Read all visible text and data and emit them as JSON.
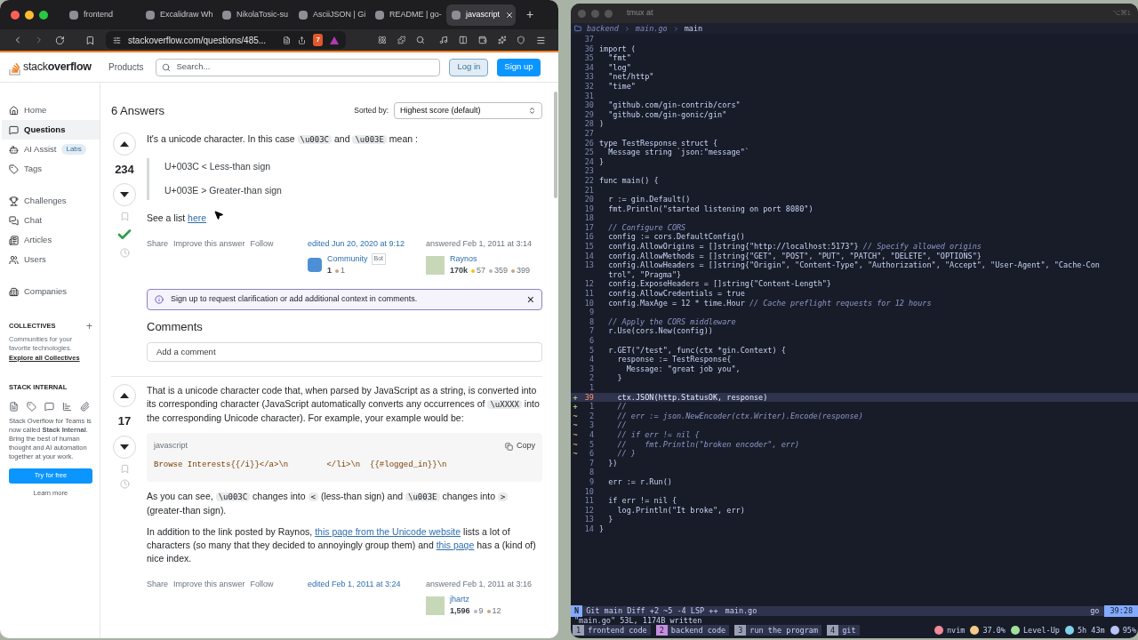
{
  "browser": {
    "tabs": [
      {
        "title": "frontend",
        "selected": false
      },
      {
        "title": "Excalidraw Wh",
        "selected": false
      },
      {
        "title": "NikolaTosic-su",
        "selected": false
      },
      {
        "title": "AsciiJSON | Gi",
        "selected": false
      },
      {
        "title": "README | go-",
        "selected": false
      },
      {
        "title": "javascript",
        "selected": true
      }
    ],
    "url": "stackoverflow.com/questions/485...",
    "shield_count": "7",
    "new_tab": "+"
  },
  "header": {
    "logo": "stack**overflow**",
    "products": "Products",
    "search_placeholder": "Search...",
    "login": "Log in",
    "signup": "Sign up"
  },
  "sidebar": {
    "groups": [
      [
        {
          "label": "Home",
          "selected": false
        },
        {
          "label": "Questions",
          "selected": true
        },
        {
          "label": "AI Assist",
          "selected": false,
          "badge": "Labs"
        },
        {
          "label": "Tags",
          "selected": false
        }
      ],
      [
        {
          "label": "Challenges",
          "selected": false
        },
        {
          "label": "Chat",
          "selected": false
        },
        {
          "label": "Articles",
          "selected": false
        },
        {
          "label": "Users",
          "selected": false
        }
      ],
      [
        {
          "label": "Companies",
          "selected": false
        }
      ]
    ],
    "collectives": {
      "heading": "COLLECTIVES",
      "add": "+",
      "text": "Communities for your favorite technologies.",
      "link": "Explore all Collectives"
    },
    "internal": {
      "heading": "STACK INTERNAL",
      "text": "Stack Overflow for Teams is now called **Stack Internal**. Bring the best of human thought and AI automation together at your work.",
      "button": "Try for free",
      "link": "Learn more"
    }
  },
  "answers_header": {
    "count": "6 Answers",
    "sort_label": "Sorted by:",
    "sort_value": "Highest score (default)"
  },
  "answers": [
    {
      "score": "234",
      "accepted": true,
      "blocks": [
        {
          "kind": "para",
          "segments": [
            {
              "kind": "text",
              "text": "It's a unicode character. In this case "
            },
            {
              "kind": "code",
              "text": "\\u003C"
            },
            {
              "kind": "text",
              "text": " and "
            },
            {
              "kind": "code",
              "text": "\\u003E"
            },
            {
              "kind": "text",
              "text": " mean :"
            }
          ]
        },
        {
          "kind": "quote",
          "lines": [
            "U+003C < Less-than sign",
            "U+003E > Greater-than sign"
          ]
        },
        {
          "kind": "para",
          "segments": [
            {
              "kind": "text",
              "text": "See a list "
            },
            {
              "kind": "link",
              "text": "here"
            }
          ]
        }
      ],
      "actions": [
        "Share",
        "Improve this answer",
        "Follow"
      ],
      "edited": {
        "label": "edited Jun 20, 2020 at 9:12",
        "user": "Community",
        "tag": "Bot",
        "rep": "1",
        "badges": [
          {
            "count": "1",
            "color": "#c9a57c"
          }
        ]
      },
      "answered": {
        "label": "answered Feb 1, 2011 at 3:14",
        "user": "Raynos",
        "rep": "170k",
        "badges": [
          {
            "count": "57",
            "color": "#f1c40f"
          },
          {
            "count": "359",
            "color": "#b4b8bc"
          },
          {
            "count": "399",
            "color": "#c9a57c"
          }
        ]
      },
      "notice": {
        "text": "Sign up to request clarification or add additional context in comments.",
        "close": "×"
      },
      "comments": {
        "heading": "Comments",
        "placeholder": "Add a comment"
      }
    },
    {
      "score": "17",
      "accepted": false,
      "blocks": [
        {
          "kind": "para",
          "segments": [
            {
              "kind": "text",
              "text": "That is a unicode character code that, when parsed by JavaScript as a string, is converted into its corresponding character (JavaScript automatically converts any occurrences of "
            },
            {
              "kind": "code",
              "text": "\\uXXXX"
            },
            {
              "kind": "text",
              "text": " into the corresponding Unicode character). For example, your example would be:"
            }
          ]
        },
        {
          "kind": "codeblock",
          "lang": "javascript",
          "copy": "Copy",
          "code": "Browse Interests{{/i}}</a>\\n        </li>\\n  {{#logged_in}}\\n"
        },
        {
          "kind": "para",
          "segments": [
            {
              "kind": "text",
              "text": "As you can see, "
            },
            {
              "kind": "code",
              "text": "\\u003C"
            },
            {
              "kind": "text",
              "text": " changes into "
            },
            {
              "kind": "code",
              "text": "<"
            },
            {
              "kind": "text",
              "text": " (less-than sign) and "
            },
            {
              "kind": "code",
              "text": "\\u003E"
            },
            {
              "kind": "text",
              "text": " changes into "
            },
            {
              "kind": "code",
              "text": ">"
            },
            {
              "kind": "text",
              "text": " (greater-than sign)."
            }
          ]
        },
        {
          "kind": "para",
          "segments": [
            {
              "kind": "text",
              "text": "In addition to the link posted by Raynos, "
            },
            {
              "kind": "link",
              "text": "this page from the Unicode website"
            },
            {
              "kind": "text",
              "text": " lists a lot of characters (so many that they decided to annoyingly group them) and "
            },
            {
              "kind": "link",
              "text": "this page"
            },
            {
              "kind": "text",
              "text": " has a (kind of) nice index."
            }
          ]
        }
      ],
      "actions": [
        "Share",
        "Improve this answer",
        "Follow"
      ],
      "edited": {
        "label": "edited Feb 1, 2011 at 3:24"
      },
      "answered": {
        "label": "answered Feb 1, 2011 at 3:16",
        "user": "jhartz",
        "rep": "1,596",
        "badges": [
          {
            "count": "9",
            "color": "#b4b8bc"
          },
          {
            "count": "12",
            "color": "#c9a57c"
          }
        ]
      }
    }
  ],
  "terminal": {
    "title": "tmux at",
    "shortcut": "⌥⌘1",
    "breadcrumb": [
      "backend",
      "main.go",
      "main"
    ],
    "lines": [
      {
        "num": "37"
      },
      {
        "num": "36",
        "text": "import ("
      },
      {
        "num": "35",
        "text": "  \"fmt\""
      },
      {
        "num": "34",
        "text": "  \"log\""
      },
      {
        "num": "33",
        "text": "  \"net/http\""
      },
      {
        "num": "32",
        "text": "  \"time\""
      },
      {
        "num": "31"
      },
      {
        "num": "30",
        "text": "  \"github.com/gin-contrib/cors\""
      },
      {
        "num": "29",
        "text": "  \"github.com/gin-gonic/gin\""
      },
      {
        "num": "28",
        "text": ")"
      },
      {
        "num": "27"
      },
      {
        "num": "26",
        "text": "type TestResponse struct {"
      },
      {
        "num": "25",
        "text": "  Message string `json:\"message\"`"
      },
      {
        "num": "24",
        "text": "}"
      },
      {
        "num": "23"
      },
      {
        "num": "22",
        "text": "func main() {"
      },
      {
        "num": "21"
      },
      {
        "num": "20",
        "text": "  r := gin.Default()"
      },
      {
        "num": "19",
        "text": "  fmt.Println(\"started listening on port 8080\")"
      },
      {
        "num": "18"
      },
      {
        "num": "17",
        "comment": "  // Configure CORS"
      },
      {
        "num": "16",
        "text": "  config := cors.DefaultConfig()"
      },
      {
        "num": "15",
        "text": "  config.AllowOrigins = []string{\"http://localhost:5173\"} ",
        "comment": "// Specify allowed origins"
      },
      {
        "num": "14",
        "text": "  config.AllowMethods = []string{\"GET\", \"POST\", \"PUT\", \"PATCH\", \"DELETE\", \"OPTIONS\"}"
      },
      {
        "num": "13",
        "text": "  config.AllowHeaders = []string{\"Origin\", \"Content-Type\", \"Authorization\", \"Accept\", \"User-Agent\", \"Cache-Con"
      },
      {
        "text": "  trol\", \"Pragma\"}"
      },
      {
        "num": "12",
        "text": "  config.ExposeHeaders = []string{\"Content-Length\"}"
      },
      {
        "num": "11",
        "text": "  config.AllowCredentials = true"
      },
      {
        "num": "10",
        "text": "  config.MaxAge = 12 * time.Hour ",
        "comment": "// Cache preflight requests for 12 hours"
      },
      {
        "num": "9"
      },
      {
        "num": "8",
        "comment": "  // Apply the CORS middleware"
      },
      {
        "num": "7",
        "text": "  r.Use(cors.New(config))"
      },
      {
        "num": "6"
      },
      {
        "num": "5",
        "text": "  r.GET(\"/test\", func(ctx *gin.Context) {"
      },
      {
        "num": "4",
        "text": "    response := TestResponse{"
      },
      {
        "num": "3",
        "text": "      Message: \"great job you\","
      },
      {
        "num": "2",
        "text": "    }"
      },
      {
        "num": "1"
      },
      {
        "num": "39",
        "text": "    ctx.JSON(http.StatusOK, response)",
        "sign": "+",
        "current": true
      },
      {
        "num": "1",
        "comment": "    //",
        "sign": "+"
      },
      {
        "num": "2",
        "comment": "    // err := json.NewEncoder(ctx.Writer).Encode(response)",
        "sign": "~"
      },
      {
        "num": "3",
        "comment": "    //",
        "sign": "~"
      },
      {
        "num": "4",
        "comment": "    // if err != nil {",
        "sign": "~"
      },
      {
        "num": "5",
        "comment": "    //    fmt.Println(\"broken encoder\", err)",
        "sign": "~"
      },
      {
        "num": "6",
        "comment": "    // }",
        "sign": "~"
      },
      {
        "num": "7",
        "text": "  })"
      },
      {
        "num": "8"
      },
      {
        "num": "9",
        "text": "  err := r.Run()"
      },
      {
        "num": "10"
      },
      {
        "num": "11",
        "text": "  if err != nil {"
      },
      {
        "num": "12",
        "text": "    log.Println(\"It broke\", err)"
      },
      {
        "num": "13",
        "text": "  }"
      },
      {
        "num": "14",
        "text": "}"
      }
    ],
    "statusline": {
      "mode": "N",
      "info": "Git main Diff +2 ~5 -4 LSP ++",
      "file": "main.go",
      "filetype": "go",
      "position": "39:28"
    },
    "message": "\"main.go\" 53L, 1174B written",
    "tmux": {
      "windows": [
        {
          "index": "1",
          "name": "frontend code",
          "color": "#9aa0b4"
        },
        {
          "index": "2",
          "name": "backend code",
          "color": "#c58fe0"
        },
        {
          "index": "3",
          "name": "run the program",
          "color": "#9aa0b4"
        },
        {
          "index": "4",
          "name": "git",
          "color": "#9aa0b4"
        }
      ],
      "status": [
        {
          "text": "nvim",
          "color": "#f08a9a"
        },
        {
          "text": "37.0%",
          "color": "#f5c98a"
        },
        {
          "text": "Level-Up",
          "color": "#9ee29b"
        },
        {
          "text": "5h 43m",
          "color": "#7fd3e8"
        },
        {
          "text": "95%",
          "color": "#b9c3f5"
        }
      ]
    }
  }
}
